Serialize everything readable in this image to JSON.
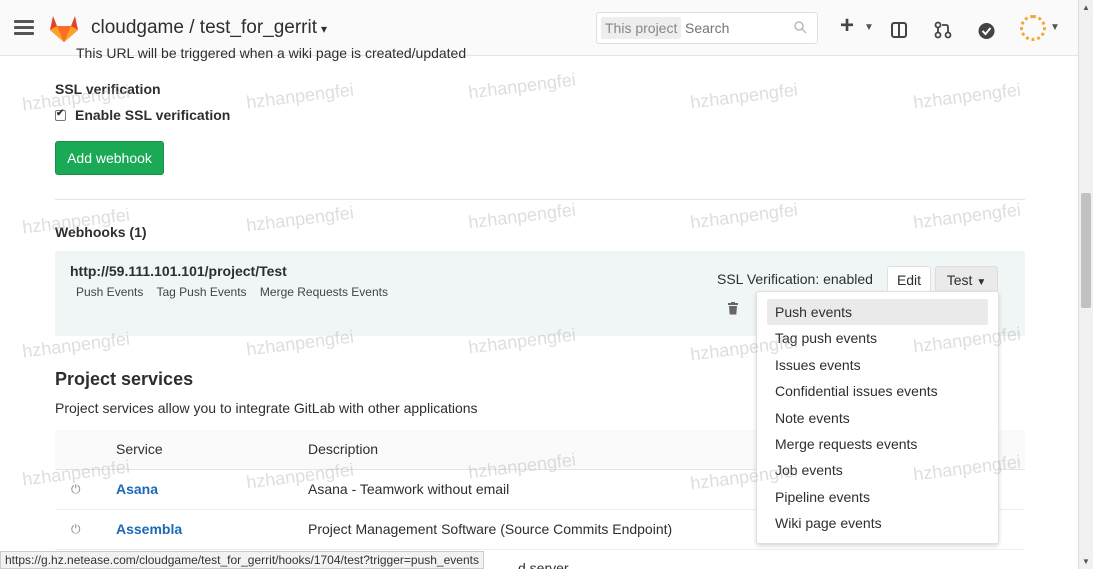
{
  "header": {
    "project_title": "cloudgame / test_for_gerrit",
    "search_scope": "This project",
    "search_placeholder": "Search"
  },
  "ssl": {
    "truncated_text": "This URL will be triggered when a wiki page is created/updated",
    "title": "SSL verification",
    "checkbox_label": "Enable SSL verification",
    "checkbox_checked": true
  },
  "add_webhook_label": "Add webhook",
  "webhooks": {
    "title": "Webhooks (1)",
    "items": [
      {
        "url": "http://59.111.101.101/project/Test",
        "events": [
          "Push Events",
          "Tag Push Events",
          "Merge Requests Events"
        ],
        "ssl_status": "SSL Verification: enabled",
        "edit_label": "Edit",
        "test_label": "Test"
      }
    ]
  },
  "test_menu": {
    "items": [
      "Push events",
      "Tag push events",
      "Issues events",
      "Confidential issues events",
      "Note events",
      "Merge requests events",
      "Job events",
      "Pipeline events",
      "Wiki page events"
    ],
    "active_index": 0
  },
  "project_services": {
    "title": "Project services",
    "description": "Project services allow you to integrate GitLab with other applications",
    "columns": [
      "Service",
      "Description"
    ],
    "rows": [
      {
        "name": "Asana",
        "description": "Asana - Teamwork without email"
      },
      {
        "name": "Assembla",
        "description": "Project Management Software (Source Commits Endpoint)"
      }
    ],
    "partial_text": "d server"
  },
  "status_bar_url": "https://g.hz.netease.com/cloudgame/test_for_gerrit/hooks/1704/test?trigger=push_events",
  "watermark": "hzhanpengfei",
  "colors": {
    "primary_button": "#1aaa55",
    "link": "#1b69b6",
    "webhook_bg": "#f0f5f6"
  }
}
